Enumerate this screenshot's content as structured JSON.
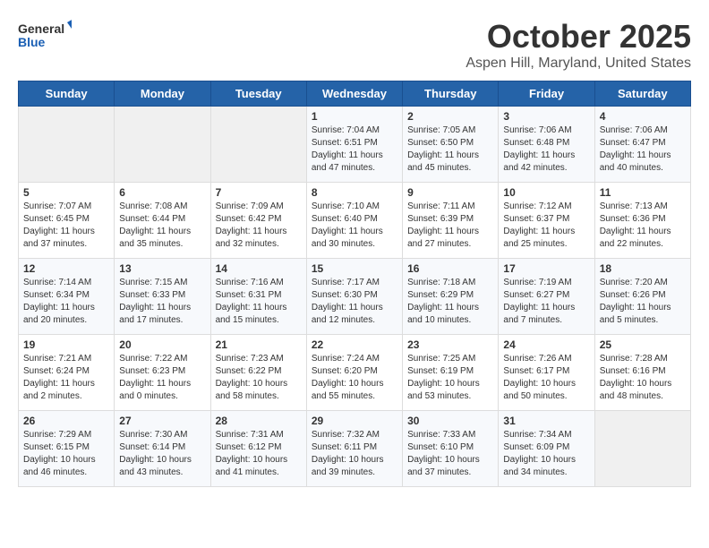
{
  "header": {
    "logo_general": "General",
    "logo_blue": "Blue",
    "month": "October 2025",
    "location": "Aspen Hill, Maryland, United States"
  },
  "weekdays": [
    "Sunday",
    "Monday",
    "Tuesday",
    "Wednesday",
    "Thursday",
    "Friday",
    "Saturday"
  ],
  "weeks": [
    [
      {
        "day": "",
        "sunrise": "",
        "sunset": "",
        "daylight": ""
      },
      {
        "day": "",
        "sunrise": "",
        "sunset": "",
        "daylight": ""
      },
      {
        "day": "",
        "sunrise": "",
        "sunset": "",
        "daylight": ""
      },
      {
        "day": "1",
        "sunrise": "Sunrise: 7:04 AM",
        "sunset": "Sunset: 6:51 PM",
        "daylight": "Daylight: 11 hours and 47 minutes."
      },
      {
        "day": "2",
        "sunrise": "Sunrise: 7:05 AM",
        "sunset": "Sunset: 6:50 PM",
        "daylight": "Daylight: 11 hours and 45 minutes."
      },
      {
        "day": "3",
        "sunrise": "Sunrise: 7:06 AM",
        "sunset": "Sunset: 6:48 PM",
        "daylight": "Daylight: 11 hours and 42 minutes."
      },
      {
        "day": "4",
        "sunrise": "Sunrise: 7:06 AM",
        "sunset": "Sunset: 6:47 PM",
        "daylight": "Daylight: 11 hours and 40 minutes."
      }
    ],
    [
      {
        "day": "5",
        "sunrise": "Sunrise: 7:07 AM",
        "sunset": "Sunset: 6:45 PM",
        "daylight": "Daylight: 11 hours and 37 minutes."
      },
      {
        "day": "6",
        "sunrise": "Sunrise: 7:08 AM",
        "sunset": "Sunset: 6:44 PM",
        "daylight": "Daylight: 11 hours and 35 minutes."
      },
      {
        "day": "7",
        "sunrise": "Sunrise: 7:09 AM",
        "sunset": "Sunset: 6:42 PM",
        "daylight": "Daylight: 11 hours and 32 minutes."
      },
      {
        "day": "8",
        "sunrise": "Sunrise: 7:10 AM",
        "sunset": "Sunset: 6:40 PM",
        "daylight": "Daylight: 11 hours and 30 minutes."
      },
      {
        "day": "9",
        "sunrise": "Sunrise: 7:11 AM",
        "sunset": "Sunset: 6:39 PM",
        "daylight": "Daylight: 11 hours and 27 minutes."
      },
      {
        "day": "10",
        "sunrise": "Sunrise: 7:12 AM",
        "sunset": "Sunset: 6:37 PM",
        "daylight": "Daylight: 11 hours and 25 minutes."
      },
      {
        "day": "11",
        "sunrise": "Sunrise: 7:13 AM",
        "sunset": "Sunset: 6:36 PM",
        "daylight": "Daylight: 11 hours and 22 minutes."
      }
    ],
    [
      {
        "day": "12",
        "sunrise": "Sunrise: 7:14 AM",
        "sunset": "Sunset: 6:34 PM",
        "daylight": "Daylight: 11 hours and 20 minutes."
      },
      {
        "day": "13",
        "sunrise": "Sunrise: 7:15 AM",
        "sunset": "Sunset: 6:33 PM",
        "daylight": "Daylight: 11 hours and 17 minutes."
      },
      {
        "day": "14",
        "sunrise": "Sunrise: 7:16 AM",
        "sunset": "Sunset: 6:31 PM",
        "daylight": "Daylight: 11 hours and 15 minutes."
      },
      {
        "day": "15",
        "sunrise": "Sunrise: 7:17 AM",
        "sunset": "Sunset: 6:30 PM",
        "daylight": "Daylight: 11 hours and 12 minutes."
      },
      {
        "day": "16",
        "sunrise": "Sunrise: 7:18 AM",
        "sunset": "Sunset: 6:29 PM",
        "daylight": "Daylight: 11 hours and 10 minutes."
      },
      {
        "day": "17",
        "sunrise": "Sunrise: 7:19 AM",
        "sunset": "Sunset: 6:27 PM",
        "daylight": "Daylight: 11 hours and 7 minutes."
      },
      {
        "day": "18",
        "sunrise": "Sunrise: 7:20 AM",
        "sunset": "Sunset: 6:26 PM",
        "daylight": "Daylight: 11 hours and 5 minutes."
      }
    ],
    [
      {
        "day": "19",
        "sunrise": "Sunrise: 7:21 AM",
        "sunset": "Sunset: 6:24 PM",
        "daylight": "Daylight: 11 hours and 2 minutes."
      },
      {
        "day": "20",
        "sunrise": "Sunrise: 7:22 AM",
        "sunset": "Sunset: 6:23 PM",
        "daylight": "Daylight: 11 hours and 0 minutes."
      },
      {
        "day": "21",
        "sunrise": "Sunrise: 7:23 AM",
        "sunset": "Sunset: 6:22 PM",
        "daylight": "Daylight: 10 hours and 58 minutes."
      },
      {
        "day": "22",
        "sunrise": "Sunrise: 7:24 AM",
        "sunset": "Sunset: 6:20 PM",
        "daylight": "Daylight: 10 hours and 55 minutes."
      },
      {
        "day": "23",
        "sunrise": "Sunrise: 7:25 AM",
        "sunset": "Sunset: 6:19 PM",
        "daylight": "Daylight: 10 hours and 53 minutes."
      },
      {
        "day": "24",
        "sunrise": "Sunrise: 7:26 AM",
        "sunset": "Sunset: 6:17 PM",
        "daylight": "Daylight: 10 hours and 50 minutes."
      },
      {
        "day": "25",
        "sunrise": "Sunrise: 7:28 AM",
        "sunset": "Sunset: 6:16 PM",
        "daylight": "Daylight: 10 hours and 48 minutes."
      }
    ],
    [
      {
        "day": "26",
        "sunrise": "Sunrise: 7:29 AM",
        "sunset": "Sunset: 6:15 PM",
        "daylight": "Daylight: 10 hours and 46 minutes."
      },
      {
        "day": "27",
        "sunrise": "Sunrise: 7:30 AM",
        "sunset": "Sunset: 6:14 PM",
        "daylight": "Daylight: 10 hours and 43 minutes."
      },
      {
        "day": "28",
        "sunrise": "Sunrise: 7:31 AM",
        "sunset": "Sunset: 6:12 PM",
        "daylight": "Daylight: 10 hours and 41 minutes."
      },
      {
        "day": "29",
        "sunrise": "Sunrise: 7:32 AM",
        "sunset": "Sunset: 6:11 PM",
        "daylight": "Daylight: 10 hours and 39 minutes."
      },
      {
        "day": "30",
        "sunrise": "Sunrise: 7:33 AM",
        "sunset": "Sunset: 6:10 PM",
        "daylight": "Daylight: 10 hours and 37 minutes."
      },
      {
        "day": "31",
        "sunrise": "Sunrise: 7:34 AM",
        "sunset": "Sunset: 6:09 PM",
        "daylight": "Daylight: 10 hours and 34 minutes."
      },
      {
        "day": "",
        "sunrise": "",
        "sunset": "",
        "daylight": ""
      }
    ]
  ]
}
